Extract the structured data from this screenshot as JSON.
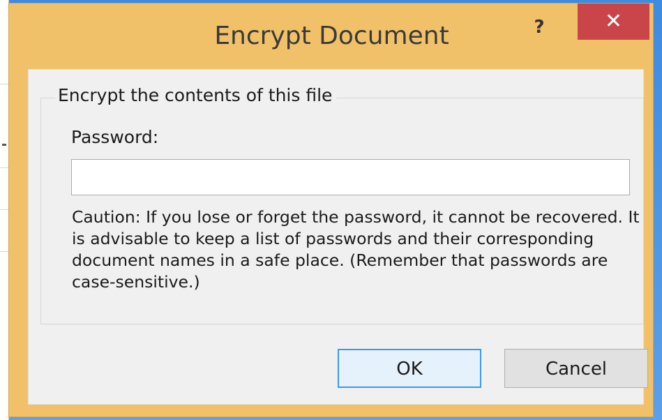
{
  "dialog": {
    "title": "Encrypt Document",
    "help_label": "?",
    "close_label": "✕"
  },
  "group": {
    "legend": "Encrypt the contents of this file"
  },
  "password": {
    "label": "Password:",
    "value": ""
  },
  "caution": {
    "text": "Caution: If you lose or forget the password, it cannot be recovered. It is advisable to keep a list of passwords and their corresponding document names in a safe place. (Remember that passwords are case-sensitive.)"
  },
  "buttons": {
    "ok_label": "OK",
    "cancel_label": "Cancel"
  },
  "colors": {
    "frame": "#f1c16a",
    "close": "#c9454a",
    "client": "#f0f0f0",
    "default_button_border": "#3c9ae2"
  }
}
